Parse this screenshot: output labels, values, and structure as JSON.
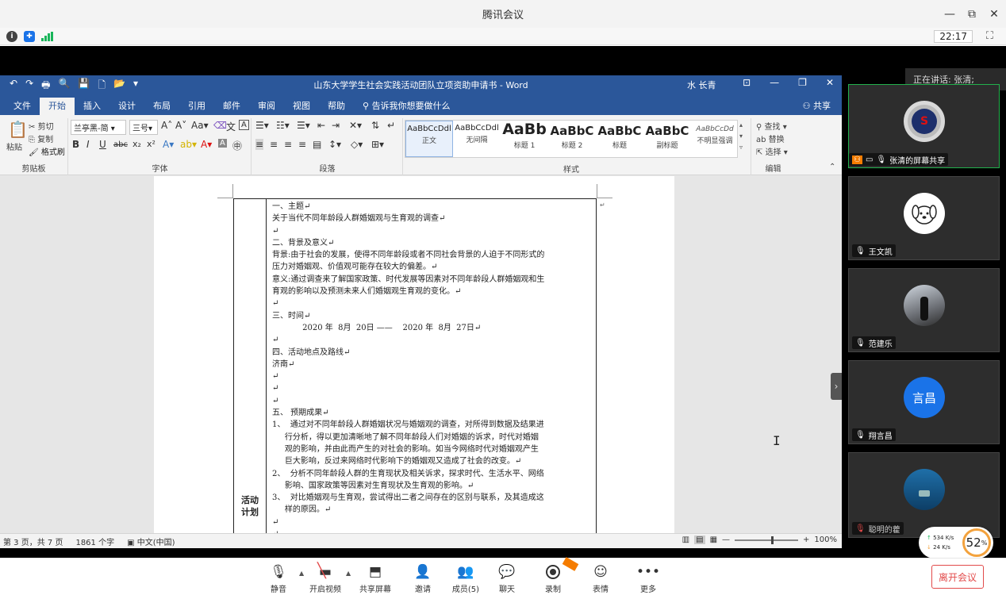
{
  "meeting": {
    "title": "腾讯会议",
    "window_controls": [
      "—",
      "⧉",
      "✕"
    ],
    "clock": "22:17",
    "status_icons": [
      "info-icon",
      "shield-icon",
      "signal-icon"
    ]
  },
  "word": {
    "qat": [
      "↶",
      "↷",
      "🖶",
      "🔍",
      "💾",
      "🗋",
      "📂",
      "▾"
    ],
    "title": "山东大学学生社会实践活动团队立项资助申请书 - Word",
    "user": "水 长青",
    "controls": [
      "⊡",
      "—",
      "❐",
      "✕"
    ],
    "tabs": [
      "文件",
      "开始",
      "插入",
      "设计",
      "布局",
      "引用",
      "邮件",
      "审阅",
      "视图",
      "帮助"
    ],
    "active_tab": "开始",
    "tell_me": "告诉我你想要做什么",
    "share": "共享",
    "ribbon": {
      "clipboard": {
        "label": "剪贴板",
        "paste": "粘贴",
        "cut": "剪切",
        "copy": "复制",
        "format_painter": "格式刷"
      },
      "font": {
        "label": "字体",
        "font_name": "兰亭黑-简",
        "font_size": "三号",
        "aa": "Aa",
        "bold": "B",
        "italic": "I",
        "underline": "U",
        "strike": "abc",
        "sub": "x₂",
        "sup": "x²"
      },
      "paragraph": {
        "label": "段落"
      },
      "styles": {
        "label": "样式",
        "items": [
          {
            "sample": "AaBbCcDdl",
            "name": "正文"
          },
          {
            "sample": "AaBbCcDdl",
            "name": "无间隔"
          },
          {
            "sample": "AaBb",
            "name": "标题 1"
          },
          {
            "sample": "AaBbC",
            "name": "标题 2"
          },
          {
            "sample": "AaBbC",
            "name": "标题"
          },
          {
            "sample": "AaBbC",
            "name": "副标题"
          },
          {
            "sample": "AaBbCcDd",
            "name": "不明显强调"
          }
        ]
      },
      "editing": {
        "label": "编辑",
        "find": "查找",
        "replace": "替换",
        "select": "选择"
      }
    },
    "document": {
      "row_label": "活动\n计划",
      "lines": [
        "一、主题↵",
        "关于当代不同年龄段人群婚姻观与生育观的调查↵",
        "↵",
        "二、背景及意义↵",
        "背景:由于社会的发展，使得不同年龄段或者不同社会背景的人迫于不同形式的",
        "压力对婚姻观、价值观可能存在较大的偏差。↵",
        "意义:通过调查来了解国家政策、时代发展等因素对不同年龄段人群婚姻观和生",
        "育观的影响以及预测未来人们婚姻观生育观的变化。↵",
        "↵",
        "三、时间↵",
        "            2020 年  8月  20日 ——    2020 年  8月  27日↵",
        "↵",
        "四、活动地点及路线↵",
        "济南↵",
        "↵",
        "↵",
        "↵",
        "五、 预期成果↵",
        "1、  通过对不同年龄段人群婚姻状况与婚姻观的调查，对所得到数据及结果进",
        "     行分析，得以更加清晰地了解不同年龄段人们对婚姻的诉求，时代对婚姻",
        "     观的影响，并由此而产生的对社会的影响。如当今网络时代对婚姻观产生",
        "     巨大影响，反过来网络时代影响下的婚姻观又造成了社会的改变。↵",
        "2、  分析不同年龄段人群的生育现状及相关诉求，探求时代、生活水平、网络",
        "     影响、国家政策等因素对生育现状及生育观的影响。↵",
        "3、  对比婚姻观与生育观，尝试得出二者之间存在的区别与联系，及其造成这",
        "     样的原因。↵",
        "↵",
        "↵"
      ]
    },
    "status": {
      "page": "第 3 页，共 7 页",
      "words": "1861 个字",
      "language": "中文(中国)",
      "zoom": "100%",
      "zoom_fraction": 0.6
    }
  },
  "panel": {
    "speaking": "正在讲话: 张清;",
    "participants": [
      {
        "name": "张清的屏幕共享",
        "avatar": "superman-avatar",
        "active": true
      },
      {
        "name": "王文凯",
        "avatar": "dog-avatar",
        "active": false
      },
      {
        "name": "范建乐",
        "avatar": "photo-avatar",
        "active": false
      },
      {
        "name": "翔言昌",
        "avatar": "text-avatar",
        "avatar_text": "言昌",
        "active": false
      },
      {
        "name": "聪明的藿",
        "avatar": "photo-avatar-2",
        "active": false
      }
    ],
    "net": {
      "up": "534 K/s",
      "down": "24 K/s",
      "cpu": "52",
      "cpu_unit": "%"
    }
  },
  "toolbar": {
    "buttons": [
      {
        "label": "静音",
        "icon": "microphone-icon"
      },
      {
        "label": "开启视频",
        "icon": "video-off-icon"
      },
      {
        "label": "共享屏幕",
        "icon": "share-screen-icon"
      },
      {
        "label": "邀请",
        "icon": "invite-icon"
      },
      {
        "label": "成员(5)",
        "icon": "members-icon"
      },
      {
        "label": "聊天",
        "icon": "chat-icon"
      },
      {
        "label": "录制",
        "icon": "record-icon"
      },
      {
        "label": "表情",
        "icon": "emoji-icon"
      },
      {
        "label": "更多",
        "icon": "more-icon"
      }
    ],
    "leave": "离开会议"
  },
  "colors": {
    "word_blue": "#2b579a",
    "active_green": "#22b14c",
    "leave_red": "#e24a4a",
    "avatar_blue": "#1a73e8"
  }
}
